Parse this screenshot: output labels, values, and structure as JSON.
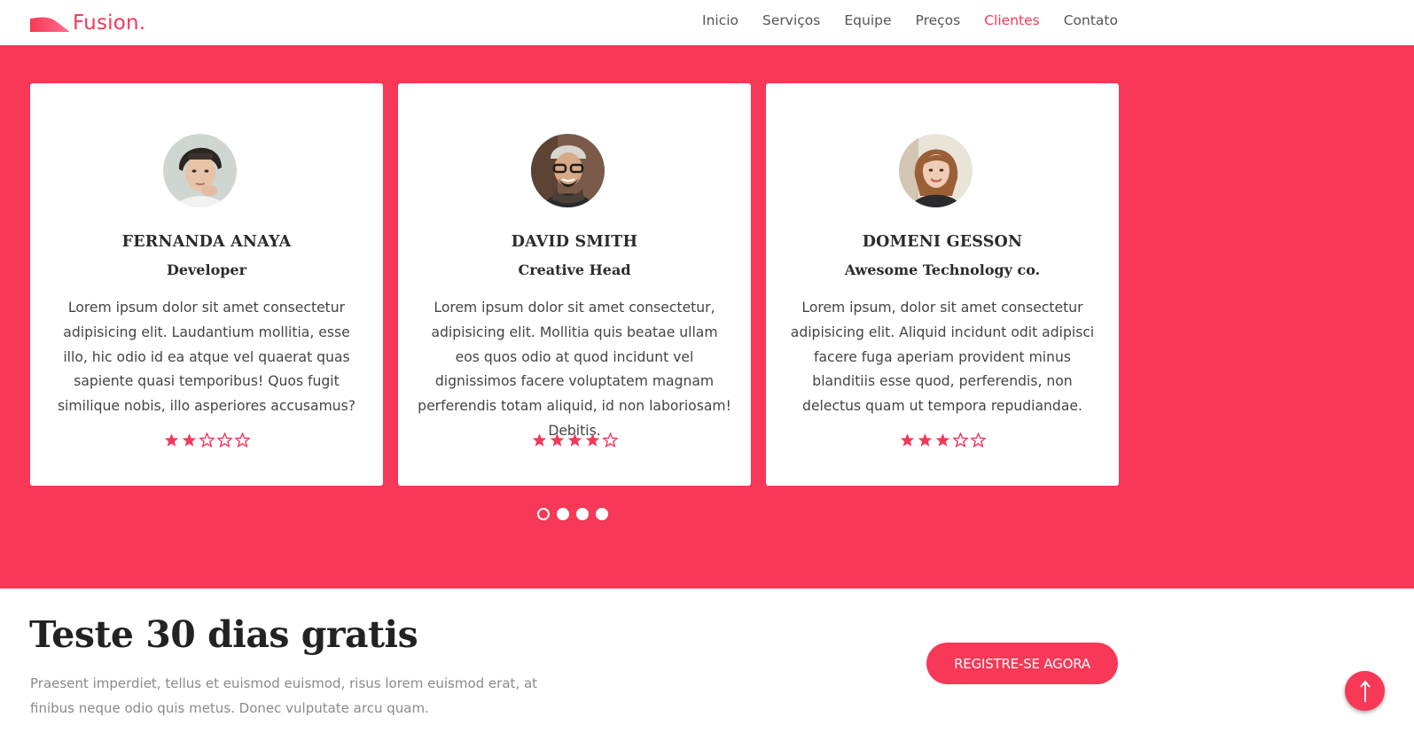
{
  "brand": {
    "name": "Fusion."
  },
  "nav": {
    "items": [
      {
        "label": "Inicio",
        "active": false
      },
      {
        "label": "Serviços",
        "active": false
      },
      {
        "label": "Equipe",
        "active": false
      },
      {
        "label": "Preços",
        "active": false
      },
      {
        "label": "Clientes",
        "active": true
      },
      {
        "label": "Contato",
        "active": false
      }
    ]
  },
  "testimonials": {
    "items": [
      {
        "name": "FERNANDA ANAYA",
        "role": "Developer",
        "quote": "Lorem ipsum dolor sit amet consectetur adipisicing elit. Laudantium mollitia, esse illo, hic odio id ea atque vel quaerat quas sapiente quasi temporibus! Quos fugit similique nobis, illo asperiores accusamus?",
        "rating": 2,
        "rating_max": 5
      },
      {
        "name": "DAVID SMITH",
        "role": "Creative Head",
        "quote": "Lorem ipsum dolor sit amet consectetur, adipisicing elit. Mollitia quis beatae ullam eos quos odio at quod incidunt vel dignissimos facere voluptatem magnam perferendis totam aliquid, id non laboriosam! Debitis.",
        "rating": 4,
        "rating_max": 5
      },
      {
        "name": "DOMENI GESSON",
        "role": "Awesome Technology co.",
        "quote": "Lorem ipsum, dolor sit amet consectetur adipisicing elit. Aliquid incidunt odit adipisci facere fuga aperiam provident minus blanditiis esse quod, perferendis, non delectus quam ut tempora repudiandae.",
        "rating": 3,
        "rating_max": 5
      }
    ],
    "pagination": {
      "count": 4,
      "active_index": 0
    }
  },
  "cta": {
    "title": "Teste 30 dias gratis",
    "text": "Praesent imperdiet, tellus et euismod euismod, risus lorem euismod erat, at finibus neque odio quis metus. Donec vulputate arcu quam.",
    "button_label": "REGISTRE-SE AGORA"
  },
  "icons": {
    "back_to_top": "arrow-up-icon",
    "rating": "star-icon",
    "logo": "wave-logo-icon"
  },
  "colors": {
    "accent": "#f73856",
    "link_active": "#f5385a",
    "text": "#444444",
    "muted": "#8a8a8a"
  }
}
